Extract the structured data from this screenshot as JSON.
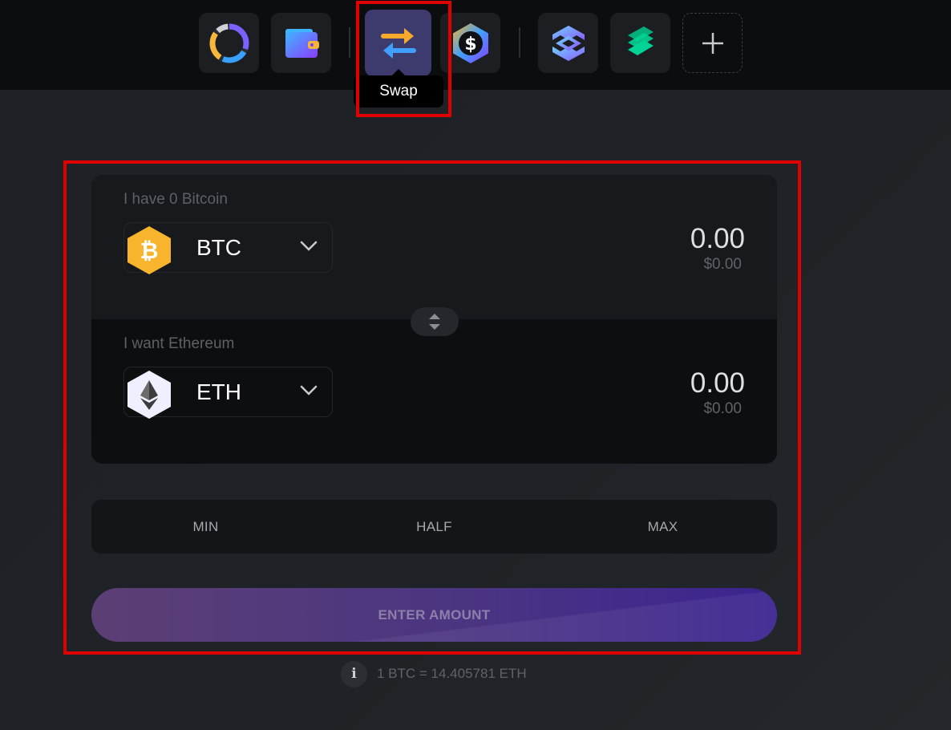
{
  "apps": [
    {
      "name": "portfolio",
      "icon": "donut-chart-icon"
    },
    {
      "name": "wallet",
      "icon": "wallet-icon"
    },
    {
      "name": "swap",
      "icon": "swap-arrows-icon",
      "active": true
    },
    {
      "name": "stablecoin",
      "icon": "dollar-hexagon-icon"
    },
    {
      "name": "exodus",
      "icon": "exodus-logo-icon"
    },
    {
      "name": "compound",
      "icon": "compound-logo-icon"
    },
    {
      "name": "add-app",
      "icon": "plus-icon"
    }
  ],
  "tooltip": {
    "label": "Swap"
  },
  "swap": {
    "from": {
      "label": "I have 0 Bitcoin",
      "ticker": "BTC",
      "amount": "0.00",
      "fiat": "$0.00",
      "icon": "bitcoin-icon",
      "color": "#f7b42c"
    },
    "to": {
      "label": "I want Ethereum",
      "ticker": "ETH",
      "amount": "0.00",
      "fiat": "$0.00",
      "icon": "ethereum-icon",
      "color": "#eef0ff"
    }
  },
  "amount_buttons": {
    "min": "MIN",
    "half": "HALF",
    "max": "MAX"
  },
  "cta": {
    "label": "ENTER AMOUNT"
  },
  "rate": {
    "info_glyph": "i",
    "text": "1 BTC = 14.405781 ETH"
  },
  "colors": {
    "accent": "#4a3582",
    "highlight": "#e00000"
  }
}
